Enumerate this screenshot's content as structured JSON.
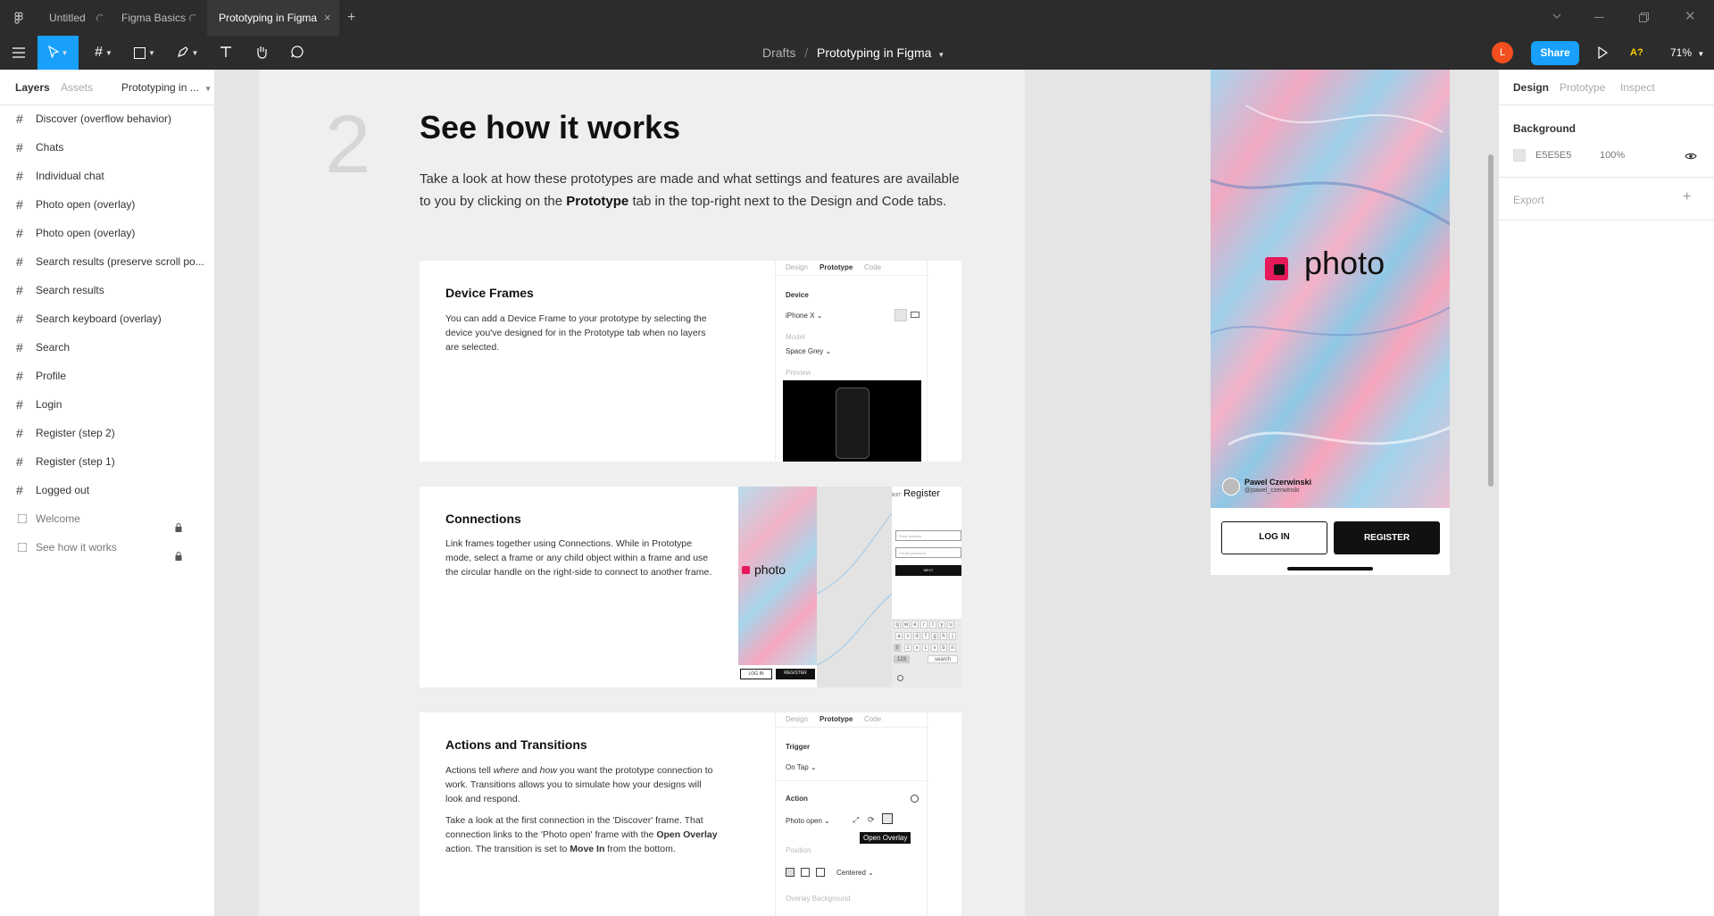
{
  "tabs": [
    {
      "label": "Untitled"
    },
    {
      "label": "Figma Basics"
    },
    {
      "label": "Prototyping in Figma",
      "active": true
    }
  ],
  "toolbar": {
    "breadcrumb_parent": "Drafts",
    "breadcrumb_sep": "/",
    "file_name": "Prototyping in Figma",
    "avatar_initial": "L",
    "share_label": "Share",
    "a11y_label": "A?",
    "zoom": "71%"
  },
  "left_panel": {
    "tab_layers": "Layers",
    "tab_assets": "Assets",
    "page_name": "Prototyping in ...",
    "layers": [
      {
        "label": "Discover (overflow behavior)"
      },
      {
        "label": "Chats"
      },
      {
        "label": "Individual chat"
      },
      {
        "label": "Photo open (overlay)"
      },
      {
        "label": "Photo open (overlay)"
      },
      {
        "label": "Search results (preserve scroll po..."
      },
      {
        "label": "Search results"
      },
      {
        "label": "Search keyboard (overlay)"
      },
      {
        "label": "Search"
      },
      {
        "label": "Profile"
      },
      {
        "label": "Login"
      },
      {
        "label": "Register (step 2)"
      },
      {
        "label": "Register (step 1)"
      },
      {
        "label": "Logged out"
      },
      {
        "label": "Welcome"
      },
      {
        "label": "See how it works"
      }
    ]
  },
  "doc": {
    "number": "2",
    "title": "See how it works",
    "intro_a": "Take a look at how these prototypes are made and what settings and features are available to you by clicking on the ",
    "intro_bold": "Prototype",
    "intro_b": " tab in the top-right next to the Design and Code tabs.",
    "cards": [
      {
        "title": "Device Frames",
        "body": "You can add a Device Frame to your prototype by selecting the device you've designed for in the Prototype tab when no layers are selected."
      },
      {
        "title": "Connections",
        "body": "Link frames together using Connections. While in Prototype mode, select a frame or any child object within a frame and use the circular handle on the right-side to connect to another frame."
      },
      {
        "title": "Actions and Transitions",
        "body_a1": "Actions tell ",
        "body_where": "where",
        "body_a2": " and ",
        "body_how": "how",
        "body_a3": " you want the prototype connection to work. Transitions allows you to simulate how your designs will look and respond.",
        "body_b1": "Take a look at the first connection in the 'Discover' frame. That connection links to the 'Photo open' frame with the ",
        "body_b_bold1": "Open Overlay",
        "body_b2": " action. The transition is set to ",
        "body_b_bold2": "Move In",
        "body_b3": " from the bottom."
      }
    ],
    "mini_panel1": {
      "tab_design": "Design",
      "tab_prototype": "Prototype",
      "tab_code": "Code",
      "device_label": "Device",
      "device_value": "iPhone X",
      "model_label": "Model",
      "model_value": "Space Grey",
      "preview_label": "Preview"
    },
    "mini_connections": {
      "photo_text": "photo",
      "login": "LOG IN",
      "register": "REGISTER",
      "register_title": "Register",
      "field1": "Email address",
      "field2": "Create password",
      "next": "NEXT",
      "keys_row1": [
        "q",
        "w",
        "e",
        "r",
        "t",
        "y",
        "u"
      ],
      "keys_row2": [
        "a",
        "s",
        "d",
        "f",
        "g",
        "h",
        "j"
      ],
      "keys_row3": [
        "z",
        "x",
        "c",
        "v",
        "b",
        "n"
      ],
      "key_123": "123",
      "key_search": "search",
      "time": "9:27"
    },
    "mini_panel3": {
      "tab_design": "Design",
      "tab_prototype": "Prototype",
      "tab_code": "Code",
      "trigger_label": "Trigger",
      "trigger_value": "On Tap",
      "action_label": "Action",
      "action_value": "Photo open",
      "tooltip": "Open Overlay",
      "position_label": "Position",
      "position_value": "Centered",
      "overlay_bg": "Overlay Background"
    }
  },
  "phone": {
    "brand": "photo",
    "author_name": "Pawel Czerwinski",
    "author_handle": "@pawel_czerwinski",
    "login_label": "LOG IN",
    "register_label": "REGISTER"
  },
  "right_panel": {
    "tab_design": "Design",
    "tab_prototype": "Prototype",
    "tab_inspect": "Inspect",
    "background_label": "Background",
    "bg_hex": "E5E5E5",
    "bg_opacity": "100%",
    "export_label": "Export"
  },
  "help_label": "?",
  "colors": {
    "accent": "#18a0fb",
    "avatar": "#f24e1e",
    "dark": "#2c2c2c"
  }
}
